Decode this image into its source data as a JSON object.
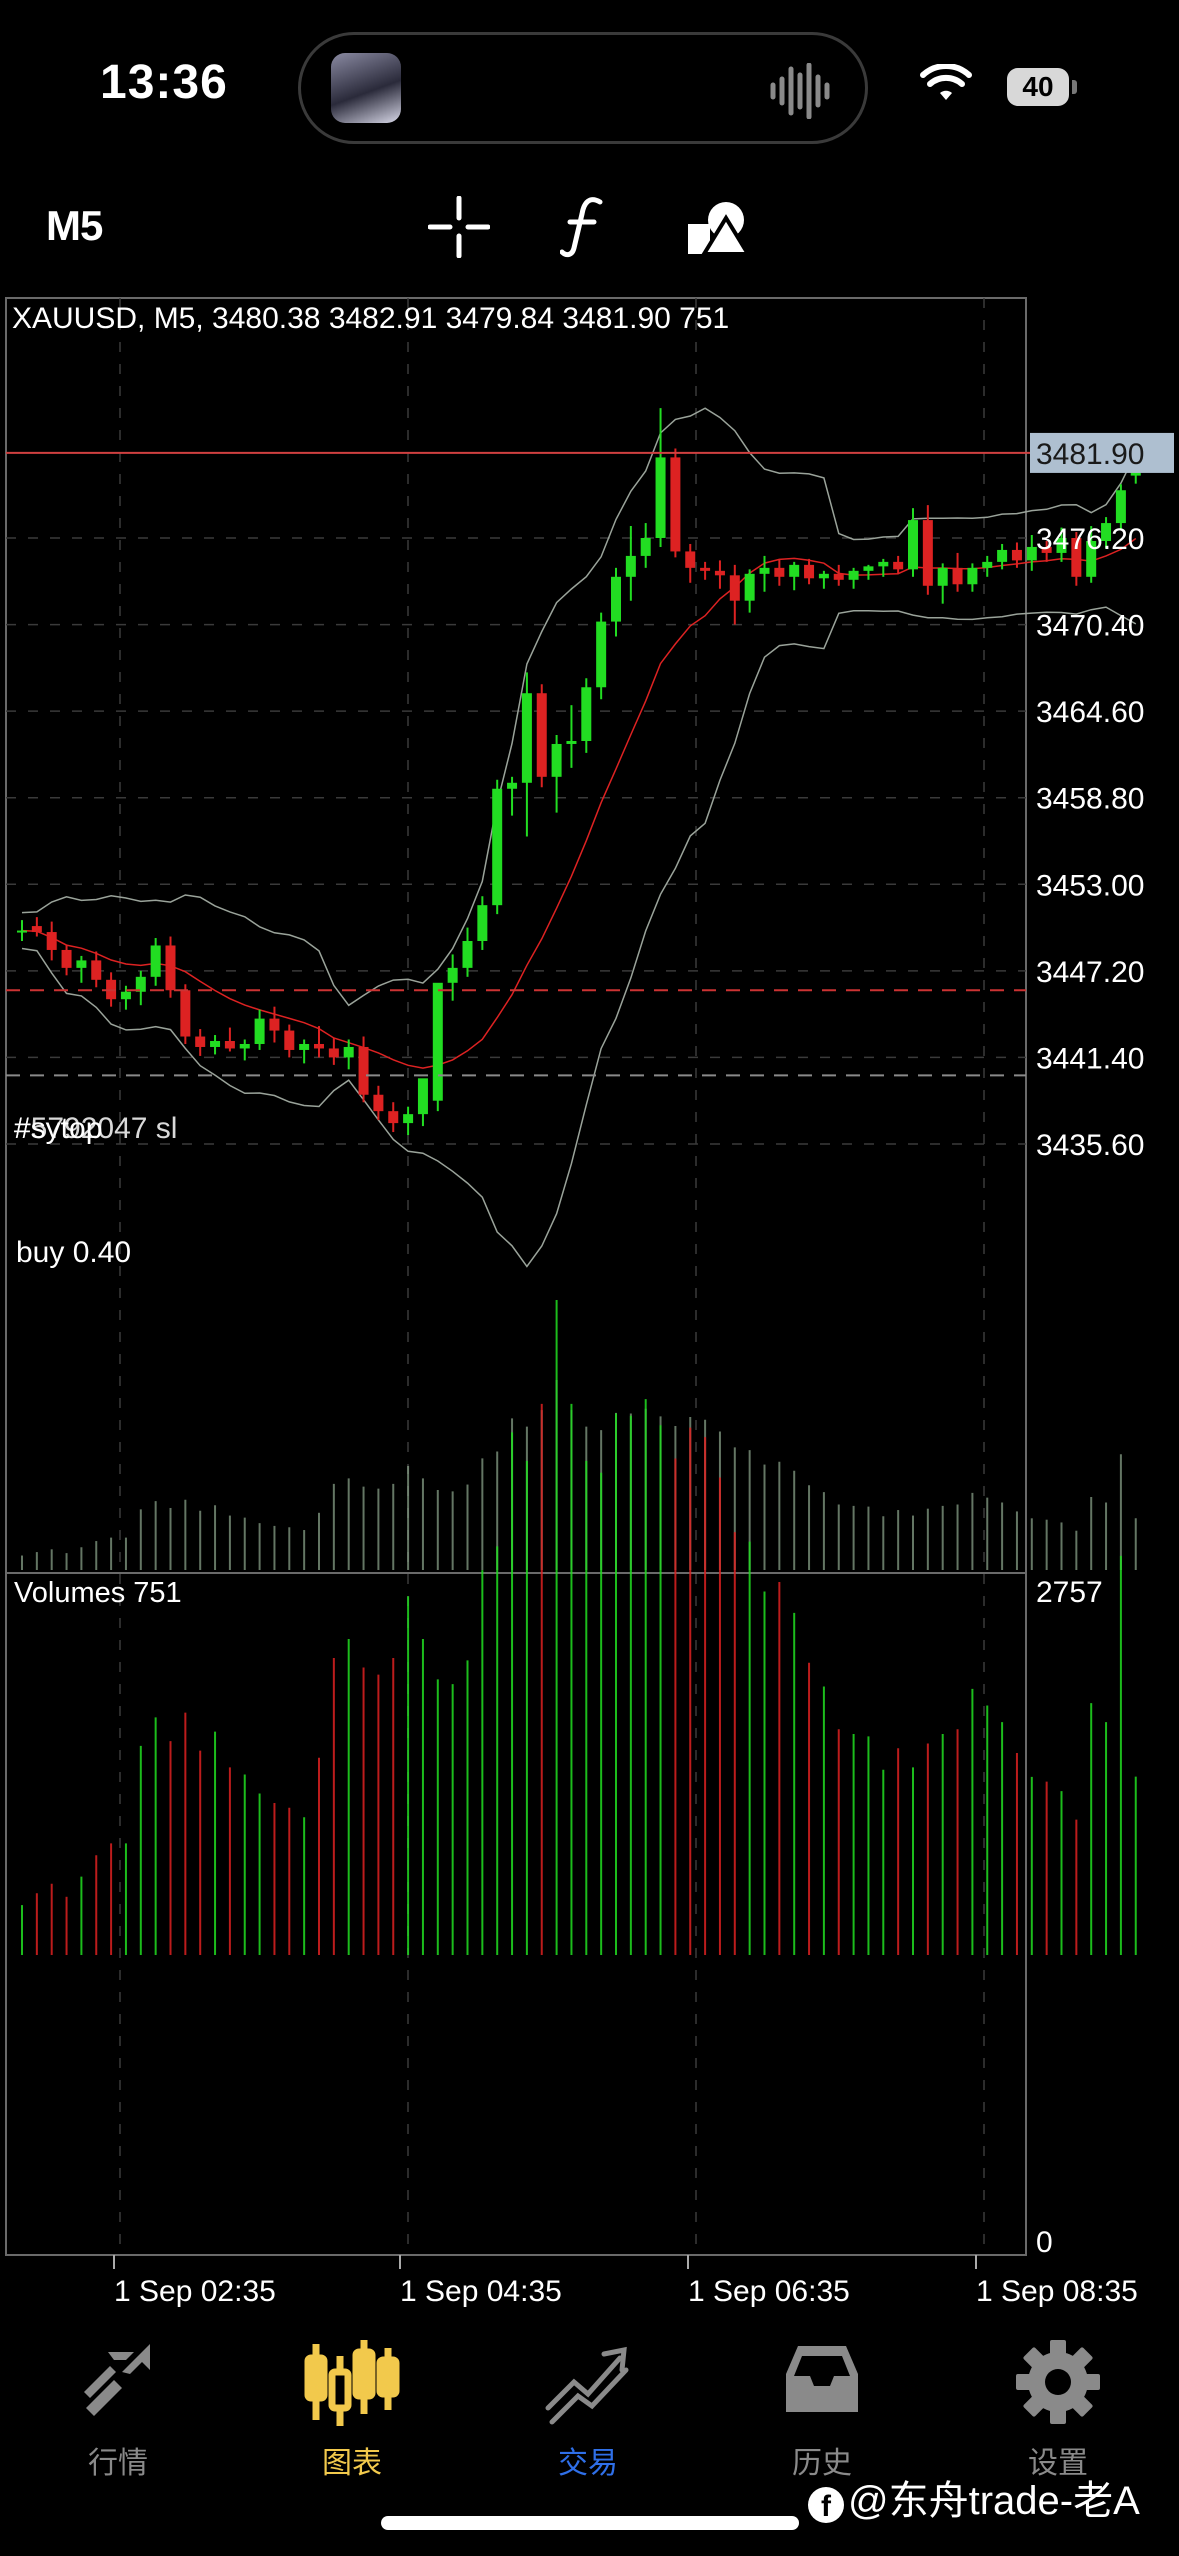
{
  "status": {
    "time": "13:36",
    "battery": "40"
  },
  "toolbar": {
    "timeframe": "M5",
    "icons": [
      "crosshair-icon",
      "function-icon",
      "objects-icon"
    ]
  },
  "chart": {
    "header": "XAUUSD, M5, 3480.38 3482.91 3479.84 3481.90 751",
    "current_price": "3481.90",
    "price_axis": [
      "3476.20",
      "3470.40",
      "3464.60",
      "3458.80",
      "3453.00",
      "3447.20",
      "3441.40",
      "3435.60"
    ],
    "sl_label": "#5792047 sl",
    "sl_overlay_label": "#sytop",
    "order_label": "buy 0.40",
    "volumes_label": "Volumes 751",
    "volume_axis": {
      "max": "2757",
      "min": "0"
    },
    "time_axis": [
      "1 Sep 02:35",
      "1 Sep 04:35",
      "1 Sep 06:35",
      "1 Sep 08:35"
    ],
    "colors": {
      "bull": "#22dd22",
      "bear": "#dd2222",
      "bands": "#9aa39a",
      "ma": "#dd2222",
      "sl_line": "#cc3333",
      "grid": "#3a3a3a",
      "price_tag_bg": "#aebfd0"
    }
  },
  "chart_data": {
    "type": "candlestick",
    "symbol": "XAUUSD",
    "timeframe": "M5",
    "last": {
      "open": 3480.38,
      "high": 3482.91,
      "low": 3479.84,
      "close": 3481.9,
      "volume": 751
    },
    "ylim": [
      3430.0,
      3486.0
    ],
    "candles": [
      [
        3449.8,
        3450.6,
        3449.2,
        3449.9
      ],
      [
        3450.2,
        3450.8,
        3449.5,
        3449.8
      ],
      [
        3449.8,
        3450.5,
        3447.9,
        3448.6
      ],
      [
        3448.6,
        3448.9,
        3446.9,
        3447.4
      ],
      [
        3447.4,
        3448.2,
        3446.4,
        3447.9
      ],
      [
        3447.9,
        3448.5,
        3446.1,
        3446.6
      ],
      [
        3446.6,
        3447.1,
        3444.8,
        3445.3
      ],
      [
        3445.3,
        3446.2,
        3444.6,
        3445.8
      ],
      [
        3445.8,
        3447.2,
        3444.9,
        3446.8
      ],
      [
        3446.8,
        3449.4,
        3446.2,
        3448.9
      ],
      [
        3448.9,
        3449.5,
        3445.4,
        3445.9
      ],
      [
        3445.9,
        3446.3,
        3442.3,
        3442.8
      ],
      [
        3442.8,
        3443.3,
        3441.5,
        3442.1
      ],
      [
        3442.1,
        3442.9,
        3441.6,
        3442.5
      ],
      [
        3442.5,
        3443.4,
        3441.8,
        3442.0
      ],
      [
        3442.0,
        3442.6,
        3441.2,
        3442.3
      ],
      [
        3442.3,
        3444.6,
        3441.9,
        3444.0
      ],
      [
        3444.0,
        3444.8,
        3442.4,
        3443.2
      ],
      [
        3443.2,
        3443.6,
        3441.4,
        3441.9
      ],
      [
        3441.9,
        3442.6,
        3441.0,
        3442.3
      ],
      [
        3442.3,
        3443.5,
        3441.4,
        3442.0
      ],
      [
        3442.0,
        3442.7,
        3440.9,
        3441.4
      ],
      [
        3441.4,
        3442.6,
        3440.6,
        3442.1
      ],
      [
        3442.1,
        3442.8,
        3438.4,
        3438.9
      ],
      [
        3438.9,
        3439.5,
        3437.2,
        3437.8
      ],
      [
        3437.8,
        3438.4,
        3436.4,
        3437.0
      ],
      [
        3437.0,
        3438.1,
        3436.2,
        3437.6
      ],
      [
        3437.6,
        3439.9,
        3436.8,
        3440.0
      ],
      [
        3438.5,
        3445.6,
        3437.8,
        3446.4
      ],
      [
        3446.4,
        3448.3,
        3445.2,
        3447.4
      ],
      [
        3447.4,
        3450.1,
        3446.8,
        3449.2
      ],
      [
        3449.2,
        3452.2,
        3448.6,
        3451.6
      ],
      [
        3451.6,
        3460.0,
        3451.0,
        3459.4
      ],
      [
        3459.4,
        3460.2,
        3457.6,
        3459.8
      ],
      [
        3459.8,
        3467.2,
        3456.2,
        3465.8
      ],
      [
        3465.8,
        3466.4,
        3459.5,
        3460.2
      ],
      [
        3460.2,
        3463.0,
        3457.8,
        3462.4
      ],
      [
        3462.4,
        3465.0,
        3460.8,
        3462.6
      ],
      [
        3462.6,
        3466.8,
        3461.8,
        3466.2
      ],
      [
        3466.2,
        3471.2,
        3465.4,
        3470.6
      ],
      [
        3470.6,
        3474.2,
        3469.6,
        3473.6
      ],
      [
        3473.6,
        3477.0,
        3472.0,
        3475.0
      ],
      [
        3475.0,
        3477.2,
        3474.2,
        3476.2
      ],
      [
        3476.2,
        3484.9,
        3475.6,
        3481.6
      ],
      [
        3481.6,
        3482.2,
        3474.9,
        3475.3
      ],
      [
        3475.3,
        3475.8,
        3473.2,
        3474.2
      ],
      [
        3474.2,
        3474.6,
        3473.4,
        3474.0
      ],
      [
        3474.0,
        3474.7,
        3472.8,
        3473.7
      ],
      [
        3473.7,
        3474.4,
        3470.4,
        3472.0
      ],
      [
        3472.0,
        3474.1,
        3471.2,
        3473.8
      ],
      [
        3473.8,
        3475.0,
        3472.6,
        3474.2
      ],
      [
        3474.2,
        3474.8,
        3473.0,
        3473.6
      ],
      [
        3473.6,
        3474.6,
        3472.7,
        3474.4
      ],
      [
        3474.4,
        3474.8,
        3473.1,
        3473.5
      ],
      [
        3473.5,
        3474.0,
        3472.8,
        3473.8
      ],
      [
        3473.8,
        3474.4,
        3473.0,
        3473.4
      ],
      [
        3473.4,
        3474.2,
        3472.8,
        3474.0
      ],
      [
        3474.0,
        3474.4,
        3473.4,
        3474.3
      ],
      [
        3474.3,
        3474.8,
        3473.6,
        3474.6
      ],
      [
        3474.6,
        3475.0,
        3473.8,
        3474.1
      ],
      [
        3474.1,
        3478.2,
        3473.6,
        3477.4
      ],
      [
        3477.4,
        3478.4,
        3472.4,
        3473.0
      ],
      [
        3473.0,
        3474.5,
        3471.8,
        3474.2
      ],
      [
        3474.2,
        3475.2,
        3472.6,
        3473.1
      ],
      [
        3473.1,
        3474.5,
        3472.6,
        3474.2
      ],
      [
        3474.2,
        3475.0,
        3473.6,
        3474.6
      ],
      [
        3474.6,
        3475.8,
        3474.1,
        3475.4
      ],
      [
        3475.4,
        3475.9,
        3474.2,
        3474.7
      ],
      [
        3474.7,
        3476.4,
        3474.0,
        3475.6
      ],
      [
        3475.6,
        3476.0,
        3474.6,
        3475.2
      ],
      [
        3475.2,
        3476.9,
        3474.6,
        3476.2
      ],
      [
        3476.2,
        3476.6,
        3473.0,
        3473.6
      ],
      [
        3473.6,
        3477.0,
        3473.2,
        3476.0
      ],
      [
        3476.0,
        3477.6,
        3475.5,
        3477.2
      ],
      [
        3477.2,
        3479.8,
        3476.8,
        3479.4
      ],
      [
        3480.38,
        3482.91,
        3479.84,
        3481.9
      ]
    ],
    "volumes": [
      210,
      260,
      300,
      245,
      330,
      420,
      470,
      470,
      880,
      1000,
      900,
      1020,
      860,
      940,
      790,
      760,
      680,
      640,
      620,
      580,
      830,
      1250,
      1330,
      1210,
      1180,
      1250,
      1510,
      1330,
      1160,
      1140,
      1240,
      1620,
      1720,
      2200,
      2080,
      2320,
      2757,
      2320,
      2080,
      2030,
      2280,
      2270,
      2340,
      2230,
      2090,
      2220,
      2180,
      2010,
      1780,
      1740,
      1530,
      1570,
      1440,
      1230,
      1130,
      950,
      930,
      920,
      780,
      870,
      790,
      890,
      930,
      950,
      1120,
      1050,
      980,
      850,
      750,
      730,
      690,
      570,
      1060,
      980,
      1680,
      751
    ],
    "stop_loss": 3445.9,
    "order_price": 3440.2,
    "order": "buy 0.40",
    "xlabels": [
      "1 Sep 02:35",
      "1 Sep 04:35",
      "1 Sep 06:35",
      "1 Sep 08:35"
    ]
  },
  "tabbar": {
    "items": [
      {
        "label": "行情",
        "icon": "quotes-icon",
        "color": "#8a8a8a"
      },
      {
        "label": "图表",
        "icon": "chart-icon",
        "color": "#f2c94c"
      },
      {
        "label": "交易",
        "icon": "trade-icon",
        "color": "#2f6fe8"
      },
      {
        "label": "历史",
        "icon": "history-icon",
        "color": "#8a8a8a"
      },
      {
        "label": "设置",
        "icon": "settings-icon",
        "color": "#8a8a8a"
      }
    ]
  },
  "watermark": {
    "text": "@东舟trade-老A"
  }
}
